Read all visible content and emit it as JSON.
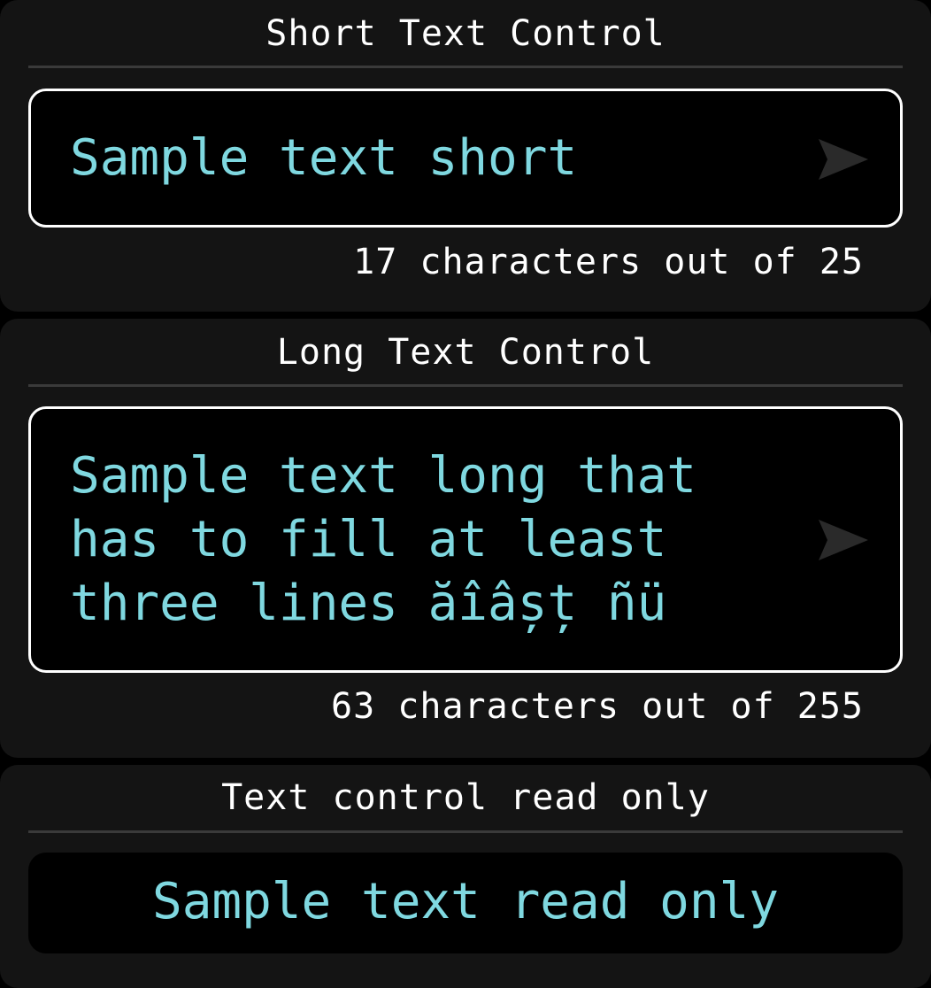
{
  "short_control": {
    "title": "Short Text Control",
    "value": "Sample text short",
    "counter": "17 characters out of 25"
  },
  "long_control": {
    "title": "Long Text Control",
    "value": "Sample text long that has to fill at least three lines ăîâșț ñü",
    "counter": "63 characters out of 255"
  },
  "readonly_control": {
    "title": "Text control read only",
    "value": "Sample text read only"
  },
  "icons": {
    "send": "send-arrow-icon"
  },
  "colors": {
    "value_text": "#7fd8e0",
    "label_text": "#ffffff",
    "panel_bg": "#141414",
    "field_bg": "#000000",
    "field_border": "#ffffff",
    "send_icon": "#2a2a2a"
  }
}
